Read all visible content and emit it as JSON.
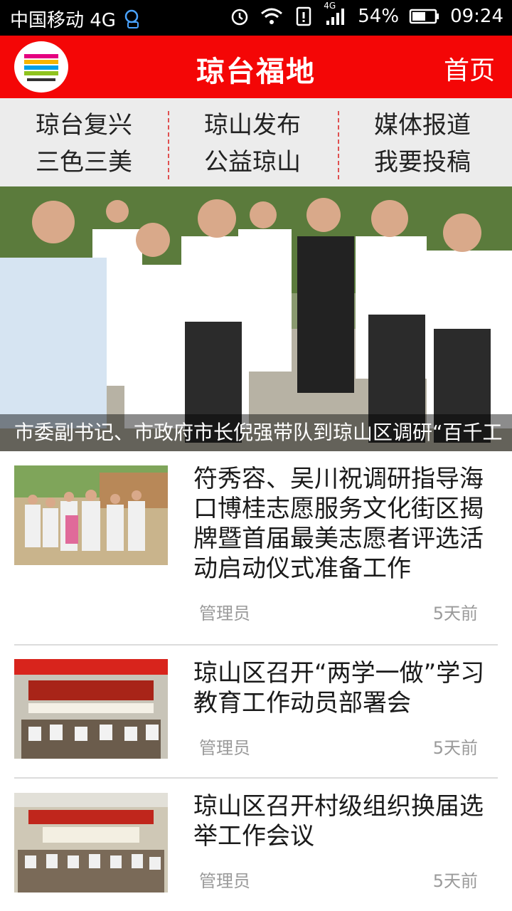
{
  "statusbar": {
    "carrier": "中国移动 4G",
    "network": "4G",
    "battery": "54%",
    "time": "09:24"
  },
  "header": {
    "title": "琼台福地",
    "home_label": "首页"
  },
  "nav": {
    "items": [
      {
        "label": "琼台复兴"
      },
      {
        "label": "琼山发布"
      },
      {
        "label": "媒体报道"
      },
      {
        "label": "三色三美"
      },
      {
        "label": "公益琼山"
      },
      {
        "label": "我要投稿"
      }
    ]
  },
  "hero": {
    "caption": "市委副书记、市政府市长倪强带队到琼山区调研“百千工"
  },
  "news": [
    {
      "title": "符秀容、吴川祝调研指导海口博桂志愿服务文化街区揭牌暨首届最美志愿者评选活动启动仪式准备工作",
      "author": "管理员",
      "time": "5天前"
    },
    {
      "title": "琼山区召开“两学一做”学习教育工作动员部署会",
      "author": "管理员",
      "time": "5天前"
    },
    {
      "title": "琼山区召开村级组织换届选举工作会议",
      "author": "管理员",
      "time": "5天前"
    }
  ],
  "colors": {
    "brand_red": "#f40606",
    "nav_bg": "#ececec",
    "divider": "#e05050"
  }
}
